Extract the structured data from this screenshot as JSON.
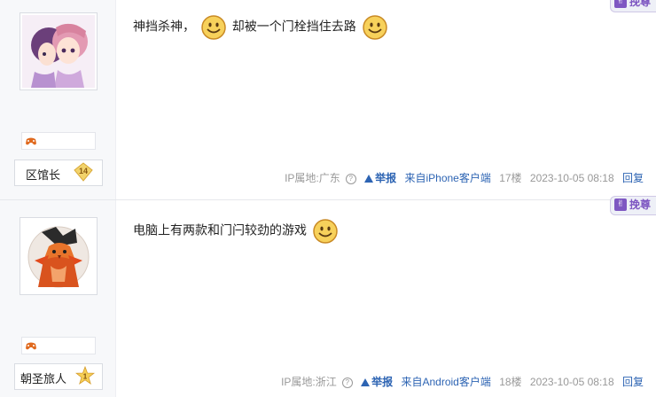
{
  "posts": [
    {
      "user": {
        "name": "区馆长",
        "level": "14",
        "level_color": "#f0c040"
      },
      "text_parts": [
        "神挡杀神，",
        "却被一个门栓挡住去路"
      ],
      "ip": "IP属地:广东",
      "report": "举报",
      "device": "来自iPhone客户端",
      "floor": "17楼",
      "time": "2023-10-05 08:18",
      "reply": "回复",
      "top_button": "挽尊"
    },
    {
      "user": {
        "name": "朝圣旅人",
        "level": "1",
        "level_color": "#f3c64b"
      },
      "text_parts": [
        "电脑上有两款和门闩较劲的游戏"
      ],
      "ip": "IP属地:浙江",
      "report": "举报",
      "device": "来自Android客户端",
      "floor": "18楼",
      "time": "2023-10-05 08:18",
      "reply": "回复",
      "top_button": "挽尊"
    }
  ],
  "icons": {
    "smiley": "smiley-emoticon-icon",
    "help": "question-circle-icon",
    "report": "warning-triangle-icon",
    "badge": "game-controller-icon",
    "like": "thumb-up-icon"
  },
  "colors": {
    "accent": "#2d64b3",
    "purple": "#7e57c2",
    "sidebar": "#f7f8fa"
  }
}
